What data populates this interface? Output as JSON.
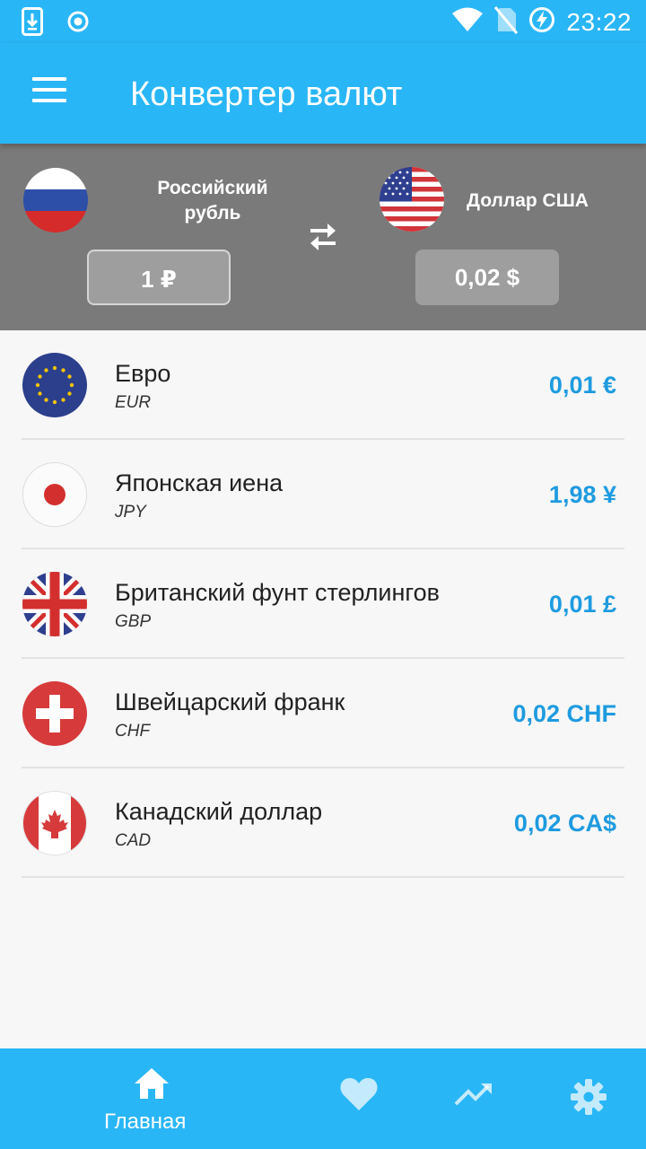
{
  "status_bar": {
    "time": "23:22"
  },
  "app_bar": {
    "title": "Конвертер валют"
  },
  "converter": {
    "from": {
      "name_line1": "Российский",
      "name_line2": "рубль",
      "value": "1 ₽"
    },
    "to": {
      "name": "Доллар США",
      "value": "0,02 $"
    }
  },
  "currencies": [
    {
      "name": "Евро",
      "code": "EUR",
      "amount": "0,01 €",
      "flag": "eu-flag-icon"
    },
    {
      "name": "Японская иена",
      "code": "JPY",
      "amount": "1,98 ¥",
      "flag": "japan-flag-icon"
    },
    {
      "name": "Британский фунт стерлингов",
      "code": "GBP",
      "amount": "0,01 £",
      "flag": "uk-flag-icon"
    },
    {
      "name": "Швейцарский франк",
      "code": "CHF",
      "amount": "0,02 CHF",
      "flag": "switzerland-flag-icon"
    },
    {
      "name": "Канадский доллар",
      "code": "CAD",
      "amount": "0,02 CA$",
      "flag": "canada-flag-icon"
    }
  ],
  "bottom_nav": {
    "home_label": "Главная"
  },
  "colors": {
    "accent": "#29b6f6",
    "amount": "#1e9be0",
    "panel": "#7a7a7a"
  }
}
